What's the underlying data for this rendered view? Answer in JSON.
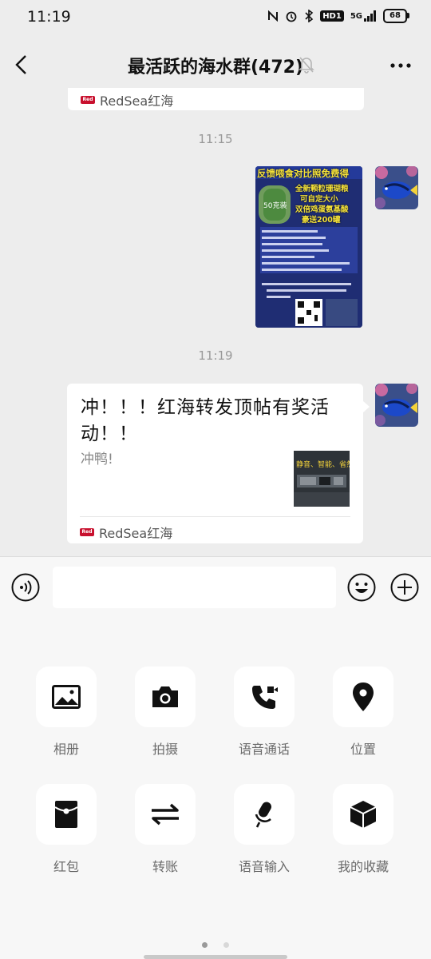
{
  "status_bar": {
    "time": "11:19",
    "network": "5G",
    "hd": "HD1",
    "battery": "68"
  },
  "header": {
    "title": "最活跃的海水群(472)"
  },
  "messages": {
    "prev_card_source": "RedSea红海",
    "time_1": "11:15",
    "poster": {
      "headline": "反馈喂食对比照免费得",
      "line1": "全新颗粒珊瑚粮",
      "line2": "可自定大小",
      "line3": "双倍鸡蛋氨基酸",
      "line4": "豪送200罐",
      "badge": "50克装"
    },
    "time_2": "11:19",
    "link_card": {
      "title": "冲！！！红海转发顶帖有奖活动！！",
      "desc": "冲鸭!",
      "thumb_text": "静音、智能、省然",
      "source": "RedSea红海"
    }
  },
  "input_bar": {
    "placeholder": ""
  },
  "actions": [
    {
      "label": "相册",
      "icon": "album-icon"
    },
    {
      "label": "拍摄",
      "icon": "camera-icon"
    },
    {
      "label": "语音通话",
      "icon": "voice-call-icon"
    },
    {
      "label": "位置",
      "icon": "location-icon"
    },
    {
      "label": "红包",
      "icon": "red-packet-icon"
    },
    {
      "label": "转账",
      "icon": "transfer-icon"
    },
    {
      "label": "语音输入",
      "icon": "voice-input-icon"
    },
    {
      "label": "我的收藏",
      "icon": "favorites-icon"
    }
  ],
  "colors": {
    "brand_red": "#c8102e",
    "poster_yellow": "#f5e23a",
    "background": "#ededed"
  }
}
